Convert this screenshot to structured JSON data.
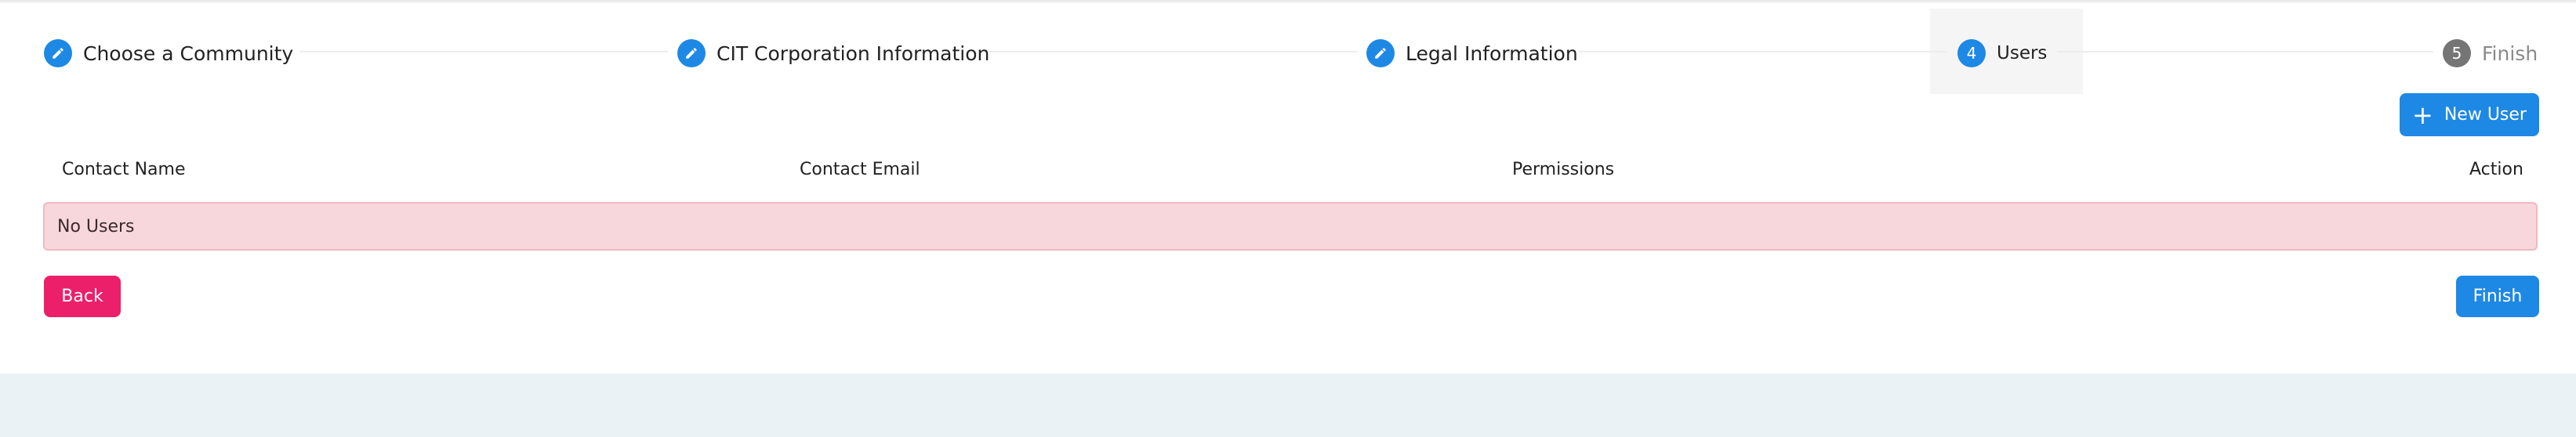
{
  "stepper": {
    "steps": [
      {
        "label": "Choose a Community",
        "icon": "pencil-icon",
        "state": "completed"
      },
      {
        "label": "CIT Corporation Information",
        "icon": "pencil-icon",
        "state": "completed"
      },
      {
        "label": "Legal Information",
        "icon": "pencil-icon",
        "state": "completed"
      },
      {
        "label": "Users",
        "number": "4",
        "state": "active"
      },
      {
        "label": "Finish",
        "number": "5",
        "state": "pending"
      }
    ]
  },
  "actions": {
    "new_user_label": "New User",
    "new_user_icon": "plus-icon",
    "back_label": "Back",
    "finish_label": "Finish"
  },
  "table": {
    "columns": [
      "Contact Name",
      "Contact Email",
      "Permissions",
      "Action"
    ],
    "empty_message": "No Users"
  },
  "colors": {
    "primary": "#1e88e5",
    "danger": "#ec1f6a",
    "empty_row_bg": "#f8d7dc",
    "page_bg": "#ebf2f6"
  }
}
